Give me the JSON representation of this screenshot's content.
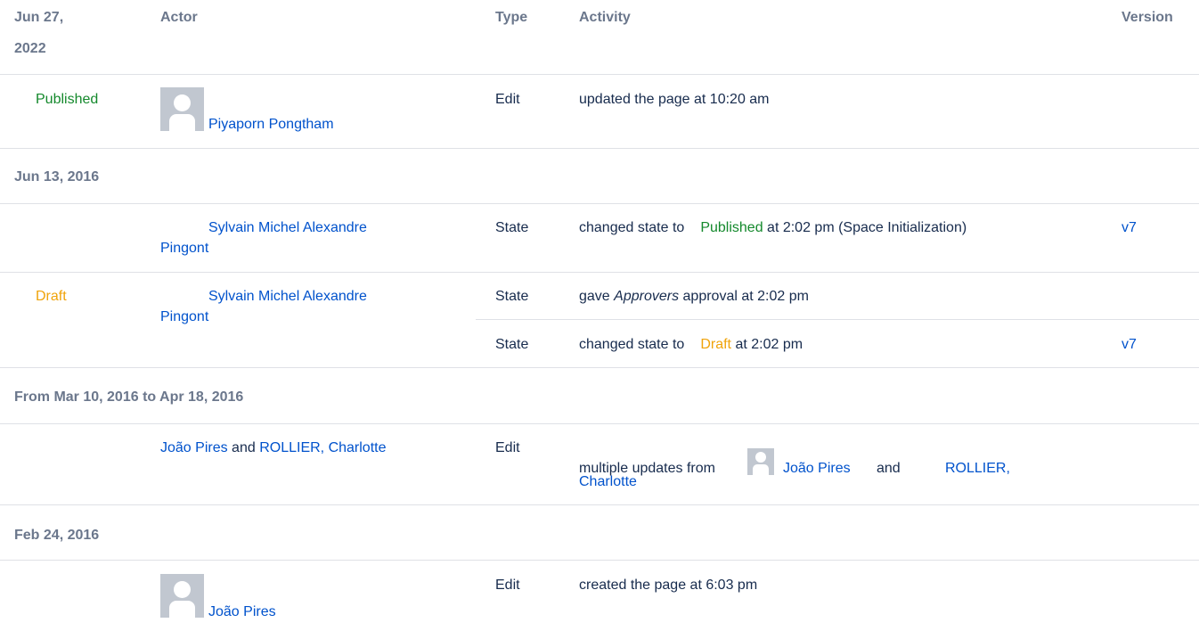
{
  "header": {
    "date_line1": "Jun 27,",
    "date_line2": "2022",
    "actor": "Actor",
    "type": "Type",
    "activity": "Activity",
    "version": "Version"
  },
  "row_jun27": {
    "state": "Published",
    "actor": "Piyaporn Pongtham",
    "type": "Edit",
    "activity": "updated the page at 10:20 am"
  },
  "group_jun13": {
    "date": "Jun 13, 2016"
  },
  "row_jun13_published": {
    "actor_line1": "Sylvain Michel Alexandre",
    "actor_line2": "Pingont",
    "type": "State",
    "activity_prefix": "changed state to",
    "activity_state": "Published",
    "activity_suffix": "at 2:02 pm (Space Initialization)",
    "version": "v7"
  },
  "row_jun13_draft": {
    "state": "Draft",
    "actor_line1": "Sylvain Michel Alexandre",
    "actor_line2": "Pingont",
    "sub1_type": "State",
    "sub1_prefix": "gave",
    "sub1_em": "Approvers",
    "sub1_suffix": "approval at 2:02 pm",
    "sub2_type": "State",
    "sub2_prefix": "changed state to",
    "sub2_state": "Draft",
    "sub2_suffix": "at 2:02 pm",
    "sub2_version": "v7"
  },
  "group_range": {
    "date": "From Mar 10, 2016 to Apr 18, 2016"
  },
  "row_range": {
    "actor_a": "João Pires",
    "actor_and": "and",
    "actor_b": "ROLLIER, Charlotte",
    "type": "Edit",
    "activity_prefix": "multiple updates from",
    "activity_actor_a": "João Pires",
    "activity_and": "and",
    "activity_actor_b_line1": "ROLLIER,",
    "activity_actor_b_line2": "Charlotte"
  },
  "group_feb24": {
    "date": "Feb 24, 2016"
  },
  "row_feb24": {
    "actor": "João Pires",
    "type": "Edit",
    "activity": "created the page at 6:03 pm"
  },
  "colors": {
    "link": "#0052cc",
    "published": "#14892c",
    "draft": "#f0a30a",
    "header_text": "#6b778c",
    "avatar_bg": "#c1c7d0",
    "divider": "#dfe1e6"
  }
}
